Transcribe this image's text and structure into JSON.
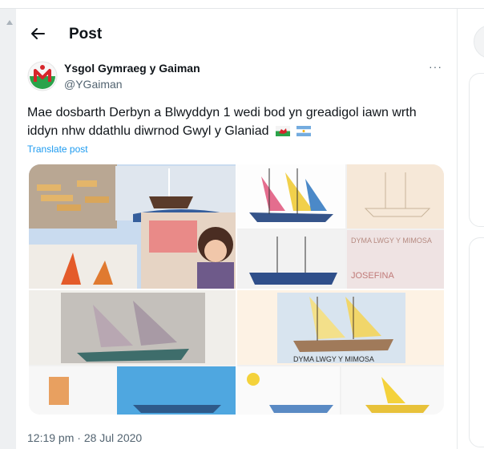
{
  "header": {
    "title": "Post"
  },
  "tweet": {
    "author_name": "Ysgol Gymraeg y Gaiman",
    "author_handle": "@YGaiman",
    "body": "Mae dosbarth Derbyn a Blwyddyn 1 wedi bod yn greadigol iawn wrth iddyn nhw ddathlu diwrnod Gwyl y Glaniad",
    "translate_label": "Translate post",
    "timestamp": "12:19 pm · 28 Jul 2020",
    "more_label": "···"
  },
  "media": {
    "caption_1": "DYMA LWGY Y MIMOSA",
    "caption_2": "DYMA LWGY Y MIMOSA",
    "caption_3": "JOSEFINA"
  },
  "colors": {
    "accent": "#1d9bf0",
    "text": "#0f1419",
    "muted": "#536471"
  },
  "icons": [
    "back-arrow-icon",
    "more-icon",
    "wales-flag-icon",
    "argentina-flag-icon"
  ]
}
